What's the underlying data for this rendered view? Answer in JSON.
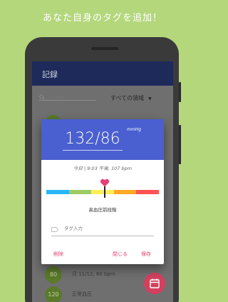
{
  "headline": "あなた自身のタグを追加！",
  "app": {
    "title": "記録",
    "search_placeholder": "タグ検索",
    "domain_filter": "すべての領域"
  },
  "list": [
    {
      "value": "",
      "text": ""
    },
    {
      "value": "80",
      "text": "月 11/12, 80 bpm"
    },
    {
      "value": "120",
      "text": "正常血圧"
    }
  ],
  "dialog": {
    "reading": "132/86",
    "unit": "mmHg",
    "timestamp": "今日 | 9:03 午後, 107 bpm",
    "stage_label": "高血圧前段階",
    "stage_position": 0.52,
    "scale_colors": [
      "#29b6f6",
      "#9ccc65",
      "#ffee58",
      "#ffa726",
      "#ff5252"
    ],
    "tag_placeholder": "タグ入力",
    "actions": {
      "delete": "削除",
      "close": "閉じる",
      "save": "保存"
    }
  },
  "colors": {
    "background": "#b4d77c",
    "header": "#4a5fd0",
    "accent": "#e0406c",
    "appbar": "#1d2a5a"
  }
}
